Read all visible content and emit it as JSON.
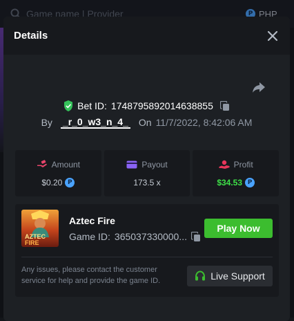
{
  "background": {
    "search_placeholder": "Game name | Provider",
    "currency": "PHP",
    "currency_coin_symbol": "P"
  },
  "modal": {
    "title": "Details",
    "bet": {
      "label": "Bet ID:",
      "id": "1748795892014638855",
      "by_label": "By",
      "user": "_r_0_w3_n_4_",
      "on_label": "On",
      "datetime": "11/7/2022, 8:42:06 AM"
    },
    "stats": {
      "amount": {
        "label": "Amount",
        "value": "$0.20"
      },
      "payout": {
        "label": "Payout",
        "value": "173.5 x"
      },
      "profit": {
        "label": "Profit",
        "value": "$34.53"
      }
    },
    "game": {
      "name": "Aztec Fire",
      "id_label": "Game ID:",
      "id_value": "365037330000...",
      "thumbnail_text_1": "AZTEC",
      "thumbnail_text_2": "FIRE",
      "play_label": "Play Now"
    },
    "support": {
      "text": "Any issues, please contact the customer service for help and provide the game ID.",
      "button_label": "Live Support"
    }
  },
  "colors": {
    "accent_green": "#3cbd2f",
    "profit_green": "#3ee048",
    "coin_blue": "#4aa3ff",
    "shield_green": "#35c25a",
    "amount_pink": "#e8456b",
    "payout_purple": "#8a63f5",
    "profit_red": "#e8365a"
  }
}
